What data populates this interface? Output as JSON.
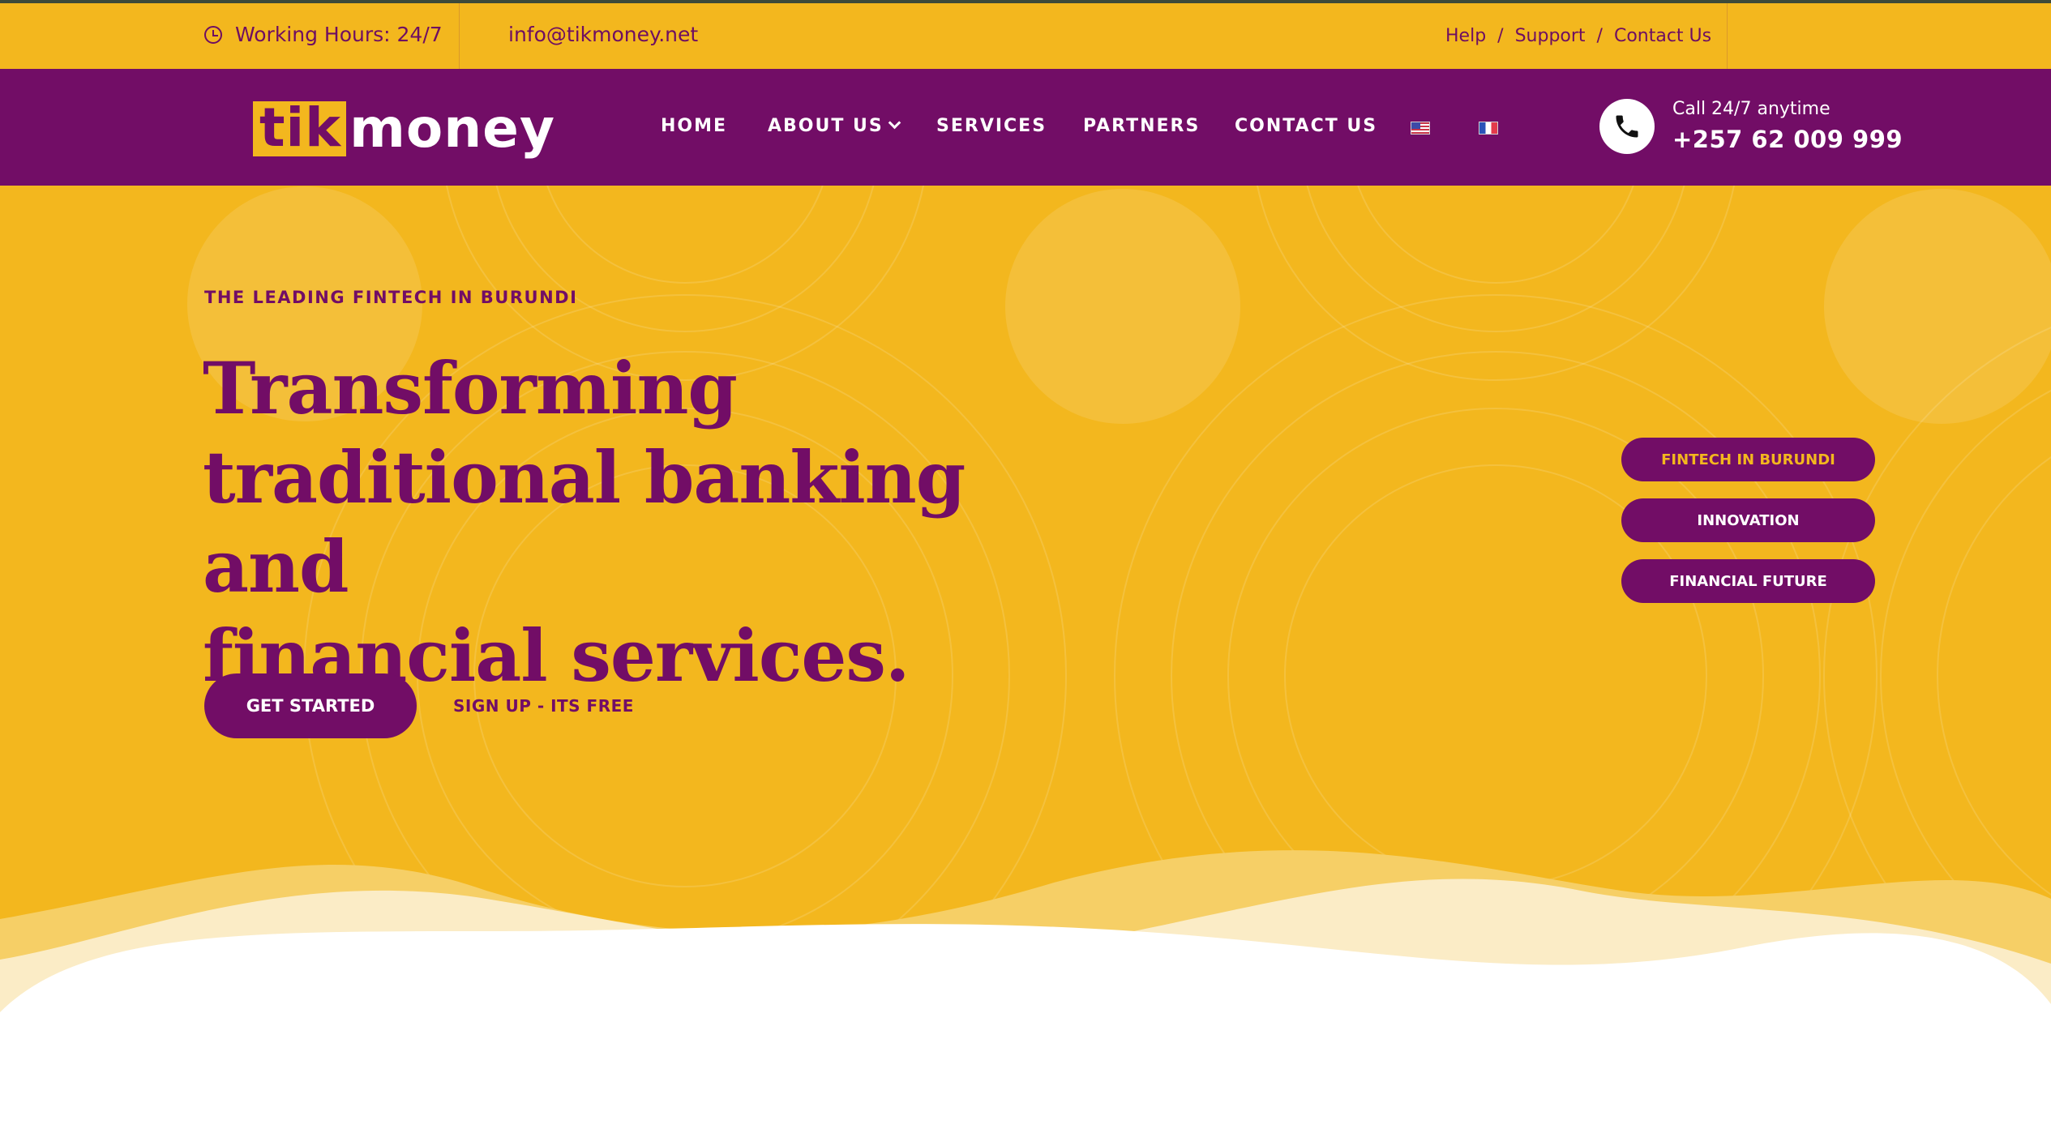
{
  "topbar": {
    "hours": "Working Hours: 24/7",
    "email": "info@tikmoney.net",
    "links": [
      "Help",
      "Support",
      "Contact Us"
    ],
    "separator": "/"
  },
  "logo": {
    "part1": "tik",
    "part2": "money"
  },
  "nav": {
    "items": [
      "HOME",
      "ABOUT US",
      "SERVICES",
      "PARTNERS",
      "CONTACT US"
    ],
    "languages": [
      "English",
      "Français"
    ]
  },
  "contact": {
    "label": "Call 24/7 anytime",
    "phone": "+257 62 009 999"
  },
  "hero": {
    "eyebrow": "THE LEADING FINTECH IN BURUNDI",
    "headline": [
      "Transforming",
      "traditional banking and",
      "financial services."
    ],
    "primary_button": "GET STARTED",
    "secondary_link": "SIGN UP - ITS FREE",
    "pills": [
      "FINTECH IN BURUNDI",
      "INNOVATION",
      "FINANCIAL FUTURE"
    ]
  },
  "colors": {
    "brand_yellow": "#f3b71e",
    "brand_purple": "#720d66"
  }
}
